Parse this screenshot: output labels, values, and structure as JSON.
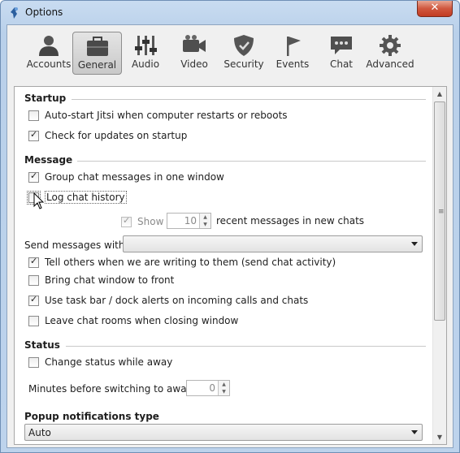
{
  "window": {
    "title": "Options",
    "close_label": "✕"
  },
  "toolbar": {
    "tabs": [
      {
        "label": "Accounts",
        "icon": "accounts-icon",
        "selected": false
      },
      {
        "label": "General",
        "icon": "general-icon",
        "selected": true
      },
      {
        "label": "Audio",
        "icon": "audio-icon",
        "selected": false
      },
      {
        "label": "Video",
        "icon": "video-icon",
        "selected": false
      },
      {
        "label": "Security",
        "icon": "security-icon",
        "selected": false
      },
      {
        "label": "Events",
        "icon": "events-icon",
        "selected": false
      },
      {
        "label": "Chat",
        "icon": "chat-icon",
        "selected": false
      },
      {
        "label": "Advanced",
        "icon": "advanced-icon",
        "selected": false
      }
    ]
  },
  "startup": {
    "title": "Startup",
    "autostart": {
      "label": "Auto-start Jitsi when computer restarts or reboots",
      "checked": false
    },
    "check_updates": {
      "label": "Check for updates on startup",
      "checked": true
    }
  },
  "message": {
    "title": "Message",
    "group_chat": {
      "label": "Group chat messages in one window",
      "checked": true
    },
    "log_history": {
      "label": "Log chat history",
      "checked": false
    },
    "show": {
      "label": "Show",
      "checked": true,
      "disabled": true
    },
    "recent_count": "10",
    "recent_label": "recent messages in new chats",
    "send_with_label": "Send messages with:",
    "send_with_value": "",
    "typing_notify": {
      "label": "Tell others when we are writing to them (send chat activity)",
      "checked": true
    },
    "bring_front": {
      "label": "Bring chat window to front",
      "checked": false
    },
    "taskbar_alerts": {
      "label": "Use task bar / dock alerts on incoming calls and chats",
      "checked": true
    },
    "leave_rooms": {
      "label": "Leave chat rooms when closing window",
      "checked": false
    }
  },
  "status": {
    "title": "Status",
    "change_away": {
      "label": "Change status while away",
      "checked": false
    },
    "minutes_label": "Minutes before switching to away:",
    "minutes_value": "0"
  },
  "popup": {
    "title": "Popup notifications type",
    "value": "Auto"
  },
  "colors": {
    "selected_tab_bg": "#c9c9c9",
    "title_bar": "#b9d0ea",
    "panel_bg": "#ffffff"
  }
}
